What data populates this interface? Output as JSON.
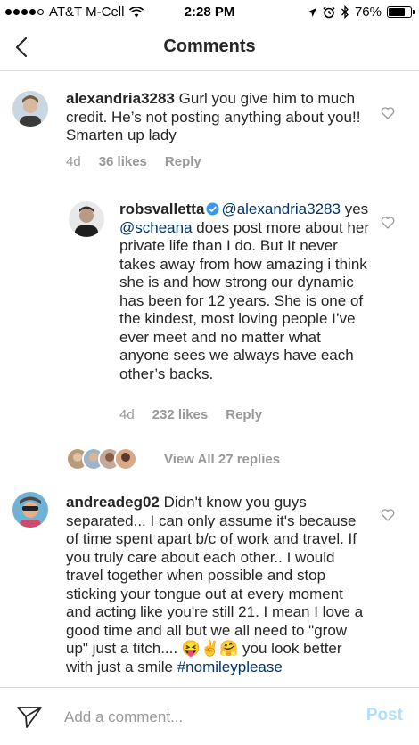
{
  "status_bar": {
    "carrier": "AT&T M-Cell",
    "time": "2:28 PM",
    "battery": "76%",
    "battery_level": 0.76,
    "icons": [
      "signal-dots",
      "wifi-icon",
      "location-arrow-icon",
      "alarm-icon",
      "bluetooth-icon",
      "battery-icon"
    ]
  },
  "nav": {
    "title": "Comments",
    "back_icon": "chevron-left-icon"
  },
  "comments": [
    {
      "username": "alexandria3283",
      "text": " Gurl you give him to much credit. He’s not posting anything about you!! Smarten up lady",
      "age": "4d",
      "likes": "36 likes",
      "reply": "Reply",
      "avatar_color": "#d9b8a0"
    },
    {
      "username": "robsvalletta",
      "verified": true,
      "mention": "@alexandria3283",
      "text_before": "yes ",
      "mention2": "@scheana",
      "text_after": " does post more about her private life than I do. But It never takes away from how amazing i think she is and how strong our dynamic has been for 12 years.  She is one of the kindest, most loving people I’ve ever meet and no matter what anyone sees we always have each other’s backs.",
      "age": "4d",
      "likes": "232 likes",
      "reply": "Reply",
      "avatar_color": "#8a8a8a"
    },
    {
      "username": "andreadeg02",
      "text": " Didn't know you guys separated... I can only assume it's because of time spent apart b/c of work and travel. If you truly care about each other.. I would travel together when possible and stop sticking your tongue out at every moment and acting like you're still 21. I mean I love a good time and all but we all need to \"grow up\" just a titch.... 😝✌️🤗 you look better with just a smile ",
      "hashtag": "#nomileyplease",
      "avatar_color": "#5aa0c8"
    }
  ],
  "view_replies": "View All 27 replies",
  "composer": {
    "placeholder": "Add a comment...",
    "post_label": "Post",
    "post_color": "#b2dffc"
  },
  "colors": {
    "link": "#003569",
    "meta": "#999999",
    "divider": "#dbdbdb"
  }
}
